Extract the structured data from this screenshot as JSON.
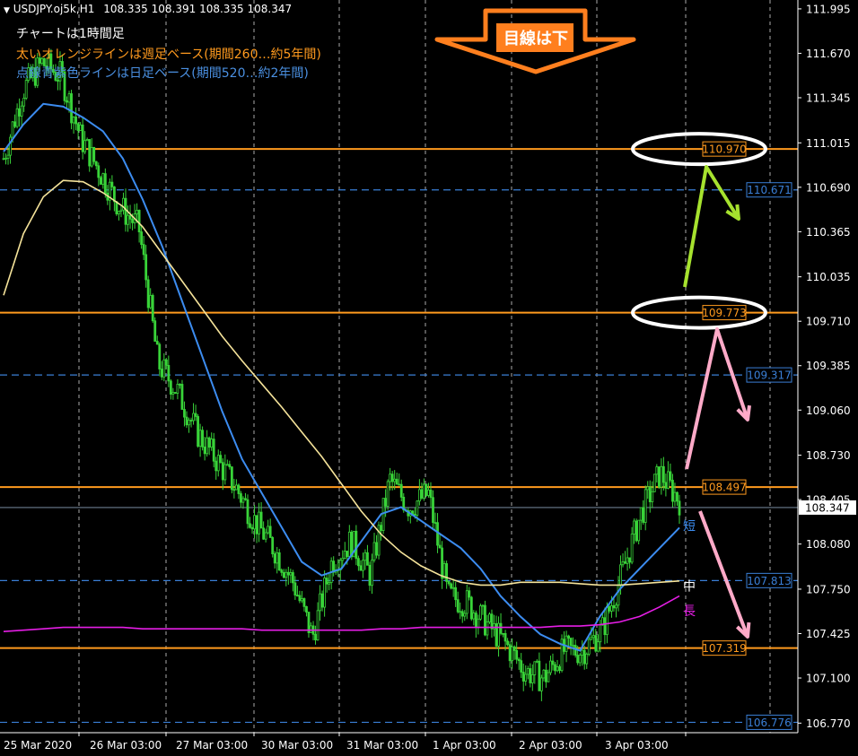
{
  "header": {
    "symbol_line": "USDJPY.oj5k,H1",
    "ohlc": "108.335 108.391 108.335 108.347"
  },
  "annotations": [
    {
      "text": "チャートは1時間足",
      "color": "#ffffff"
    },
    {
      "text": "太いオレンジラインは週足ベース(期間260…約5年間)",
      "color": "#ff9a1e"
    },
    {
      "text": "点線青紫色ラインは日足ベース(期間520…約2年間)",
      "color": "#4a8fe0"
    }
  ],
  "callout": {
    "text": "目線は下",
    "fill": "#ff7f1e",
    "text_color": "#ffffff"
  },
  "colors": {
    "background": "#000000",
    "candle": "#39d339",
    "weekly_level": "#ff9a1e",
    "daily_level": "#3a7fd6",
    "ma_short": "#3c8cf0",
    "ma_mid": "#f5e39a",
    "ma_long": "#e51ee5",
    "grid": "#c8c8c8",
    "axis_text": "#ffffff",
    "arrow_green": "#a6e22e",
    "arrow_pink": "#ffaac8",
    "ellipse": "#ffffff"
  },
  "chart_data": {
    "type": "line",
    "title": "USDJPY.oj5k,H1",
    "y_ticks": [
      "111.995",
      "111.670",
      "111.345",
      "111.015",
      "110.690",
      "110.365",
      "110.035",
      "109.710",
      "109.385",
      "109.060",
      "108.730",
      "108.405",
      "108.080",
      "107.750",
      "107.425",
      "107.100",
      "106.770"
    ],
    "ylim": [
      106.7,
      112.06
    ],
    "x_tick_labels": [
      "25 Mar 2020",
      "26 Mar 03:00",
      "27 Mar 03:00",
      "30 Mar 03:00",
      "31 Mar 03:00",
      "1 Apr 03:00",
      "2 Apr 03:00",
      "3 Apr 03:00"
    ],
    "current_price": {
      "value": 108.347,
      "label": "108.347"
    },
    "weekly_levels": [
      {
        "value": 110.97,
        "label": "110.970",
        "circled": true
      },
      {
        "value": 109.773,
        "label": "109.773",
        "circled": true
      },
      {
        "value": 108.497,
        "label": "108.497",
        "circled": false
      },
      {
        "value": 107.319,
        "label": "107.319",
        "circled": false
      }
    ],
    "daily_levels": [
      {
        "value": 110.671,
        "label": "110.671"
      },
      {
        "value": 109.317,
        "label": "109.317"
      },
      {
        "value": 107.813,
        "label": "107.813"
      },
      {
        "value": 106.776,
        "label": "106.776"
      }
    ],
    "ma_labels": [
      {
        "text": "短",
        "value": 108.22,
        "color": "#3c8cf0"
      },
      {
        "text": "中",
        "value": 107.78,
        "color": "#ffffff"
      },
      {
        "text": "長",
        "value": 107.6,
        "color": "#e51ee5"
      }
    ],
    "series": [
      {
        "name": "短",
        "key": "short",
        "values": [
          110.95,
          111.15,
          111.3,
          111.28,
          111.2,
          111.1,
          110.9,
          110.6,
          110.25,
          109.85,
          109.45,
          109.05,
          108.7,
          108.45,
          108.2,
          107.95,
          107.85,
          107.9,
          108.1,
          108.3,
          108.35,
          108.25,
          108.15,
          108.05,
          107.9,
          107.7,
          107.55,
          107.42,
          107.35,
          107.3,
          107.55,
          107.75,
          107.9,
          108.05,
          108.2
        ]
      },
      {
        "name": "中",
        "key": "mid",
        "values": [
          109.9,
          110.35,
          110.62,
          110.74,
          110.73,
          110.65,
          110.55,
          110.4,
          110.2,
          110.0,
          109.8,
          109.6,
          109.42,
          109.25,
          109.08,
          108.9,
          108.72,
          108.52,
          108.32,
          108.15,
          108.02,
          107.92,
          107.85,
          107.8,
          107.78,
          107.78,
          107.8,
          107.8,
          107.8,
          107.79,
          107.78,
          107.78,
          107.79,
          107.8,
          107.81
        ]
      },
      {
        "name": "長",
        "key": "long",
        "values": [
          107.44,
          107.45,
          107.46,
          107.47,
          107.47,
          107.47,
          107.47,
          107.46,
          107.46,
          107.46,
          107.46,
          107.46,
          107.46,
          107.45,
          107.45,
          107.45,
          107.45,
          107.45,
          107.45,
          107.46,
          107.46,
          107.47,
          107.47,
          107.47,
          107.47,
          107.47,
          107.47,
          107.47,
          107.48,
          107.48,
          107.49,
          107.51,
          107.55,
          107.62,
          107.7
        ]
      },
      {
        "name": "price",
        "key": "price",
        "values": [
          110.9,
          111.4,
          111.6,
          111.5,
          111.05,
          110.8,
          110.55,
          110.4,
          109.4,
          109.2,
          108.9,
          108.7,
          108.5,
          108.25,
          108.05,
          107.8,
          107.4,
          107.95,
          108.1,
          107.85,
          108.55,
          108.35,
          108.45,
          107.7,
          107.65,
          107.5,
          107.35,
          107.15,
          107.1,
          107.3,
          107.3,
          107.45,
          107.85,
          108.3,
          108.6,
          108.4
        ]
      }
    ]
  }
}
